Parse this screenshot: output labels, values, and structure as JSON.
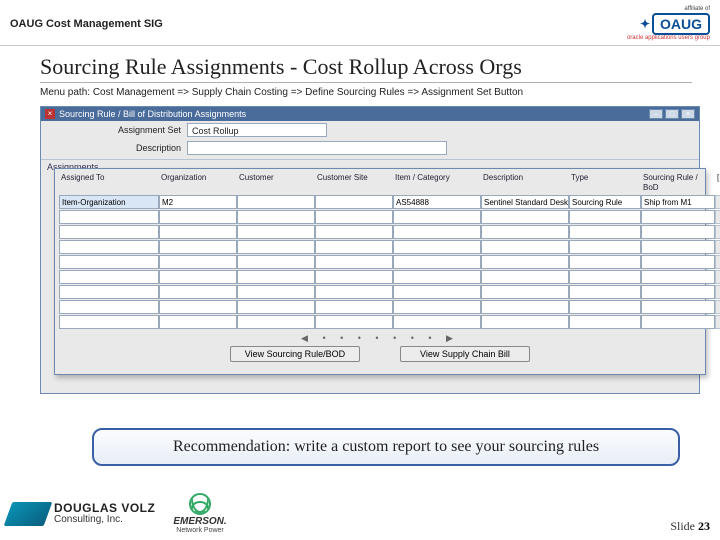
{
  "header": {
    "sig": "OAUG Cost Management SIG",
    "affiliate": "affiliate of",
    "oaug": "OAUG",
    "oaug_sub": "oracle applications users group"
  },
  "slide": {
    "title": "Sourcing Rule Assignments - Cost Rollup Across Orgs",
    "menu_path": "Menu path:  Cost Management => Supply Chain Costing => Define Sourcing Rules => Assignment Set Button"
  },
  "window": {
    "title": "Sourcing Rule / Bill of Distribution Assignments",
    "fields": {
      "assignment_set_label": "Assignment Set",
      "assignment_set_value": "Cost Rollup",
      "description_label": "Description",
      "description_value": ""
    },
    "section": "Assignments",
    "columns": {
      "assigned_to": "Assigned To",
      "organization": "Organization",
      "customer": "Customer",
      "customer_site": "Customer Site",
      "item_category": "Item / Category",
      "description": "Description",
      "type": "Type",
      "sourcing": "Sourcing Rule / BoD"
    },
    "row1": {
      "assigned_to": "Item-Organization",
      "organization": "M2",
      "customer": " ",
      "customer_site": " ",
      "item_category": "AS54888",
      "description": "Sentinel Standard Desktop",
      "type": "Sourcing Rule",
      "sourcing": "Ship from M1"
    },
    "buttons": {
      "view_sourcing": "View Sourcing Rule/BOD",
      "view_supply": "View Supply Chain Bill"
    }
  },
  "recommend": "Recommendation:  write a custom report to see your sourcing rules",
  "footer": {
    "dv_name": "DOUGLAS VOLZ",
    "dv_sub": "Consulting, Inc.",
    "emerson": "EMERSON.",
    "emerson_sub": "Network Power",
    "slide_label": "Slide ",
    "slide_no": "23"
  }
}
